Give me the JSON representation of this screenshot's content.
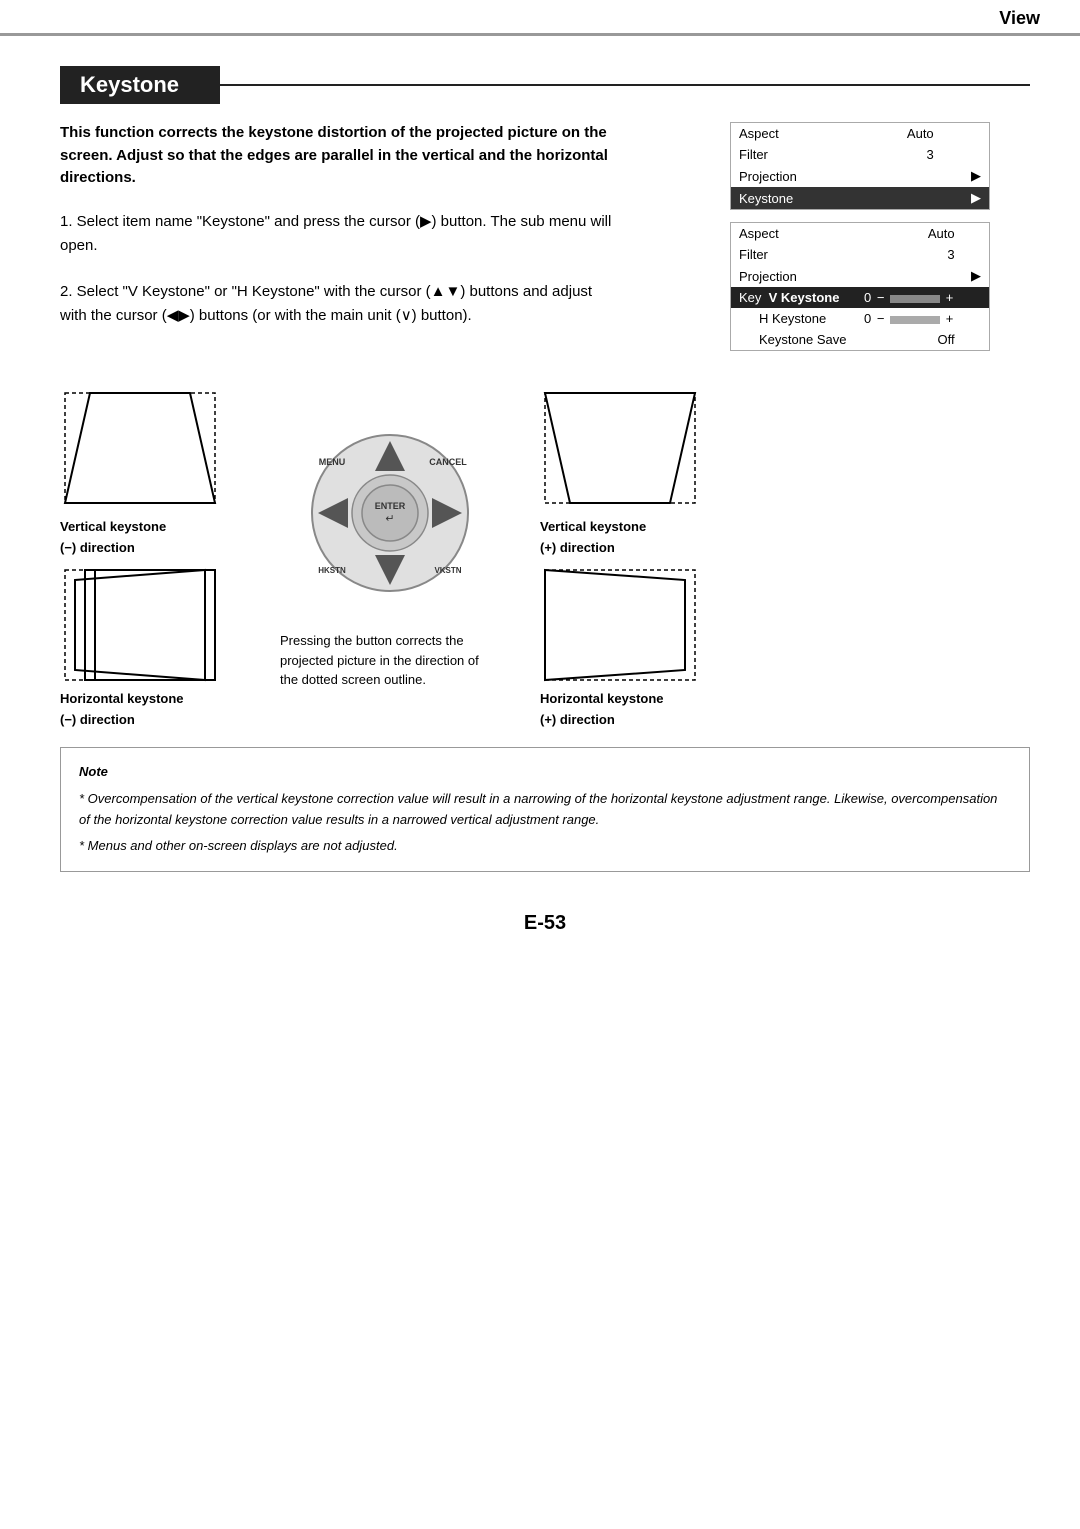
{
  "header": {
    "title": "View"
  },
  "section": {
    "heading": "Keystone",
    "intro": "This function corrects the keystone distortion of the projected picture on the screen. Adjust so that the edges are parallel in the vertical and the horizontal directions."
  },
  "steps": [
    {
      "number": "1.",
      "text": "Select item name \"Keystone\" and press the cursor (▶) button. The sub menu will open."
    },
    {
      "number": "2.",
      "text": "Select \"V Keystone\" or \"H Keystone\" with the cursor (▲▼) buttons and adjust with the cursor (◀▶) buttons (or with the main unit (∨) button)."
    }
  ],
  "menu1": {
    "rows": [
      {
        "label": "Aspect",
        "value": "Auto",
        "arrow": ""
      },
      {
        "label": "Filter",
        "value": "3",
        "arrow": ""
      },
      {
        "label": "Projection",
        "value": "",
        "arrow": "▶"
      },
      {
        "label": "Keystone",
        "value": "",
        "arrow": "▶",
        "highlighted": true
      }
    ]
  },
  "menu2": {
    "rows": [
      {
        "label": "Aspect",
        "value": "Auto",
        "arrow": ""
      },
      {
        "label": "Filter",
        "value": "3",
        "arrow": ""
      },
      {
        "label": "Projection",
        "value": "",
        "arrow": "▶"
      },
      {
        "label": "Key",
        "sublabel": "V Keystone",
        "value": "0",
        "dash": "−",
        "slider": true,
        "plus": "+",
        "highlighted": true
      },
      {
        "label": "",
        "sublabel": "H Keystone",
        "value": "0",
        "dash": "−",
        "slider": true,
        "plus": "+"
      },
      {
        "label": "",
        "sublabel": "Keystone Save",
        "value": "Off",
        "arrow": ""
      }
    ]
  },
  "diagrams": {
    "vertical_minus": {
      "label1": "Vertical  keystone",
      "label2": "(−) direction"
    },
    "vertical_plus": {
      "label1": "Vertical  keystone",
      "label2": "(+) direction"
    },
    "horizontal_minus": {
      "label1": "Horizontal  keystone",
      "label2": "(−) direction"
    },
    "horizontal_plus": {
      "label1": "Horizontal  keystone",
      "label2": "(+) direction"
    },
    "press_text": "Pressing the button corrects the projected picture in the direction of the dotted screen outline."
  },
  "remote": {
    "menu": "MENU",
    "cancel": "CANCEL",
    "enter": "ENTER",
    "hkstn": "HKSTN",
    "vkstn": "VKSTN"
  },
  "note": {
    "title": "Note",
    "lines": [
      "* Overcompensation of the vertical keystone correction value will result in a narrowing of the horizontal keystone adjustment range. Likewise, overcompensation of the horizontal keystone correction value results in a narrowed vertical adjustment range.",
      "* Menus and other on-screen displays are not adjusted."
    ]
  },
  "page": "E-53"
}
